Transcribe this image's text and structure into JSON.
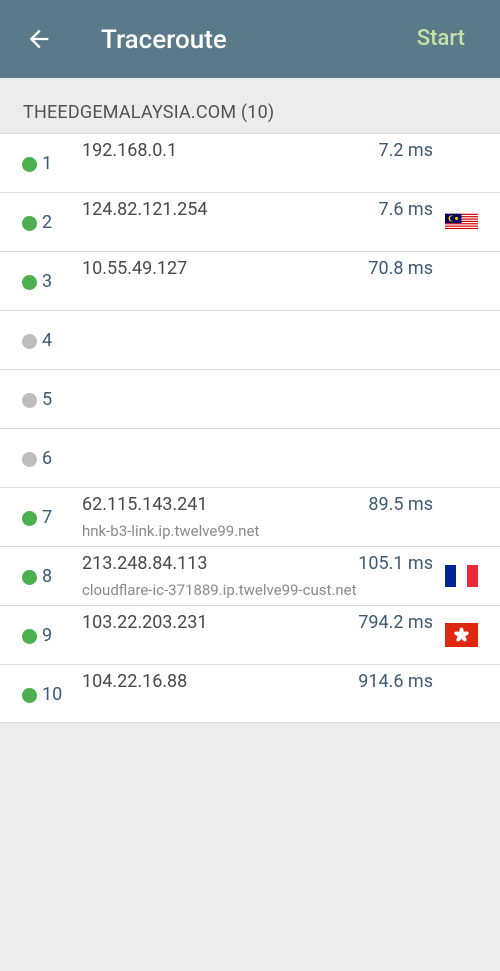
{
  "appbar": {
    "back_icon": "arrow-left-icon",
    "title": "Traceroute",
    "start_label": "Start",
    "bg_color": "#5a7a89",
    "start_color": "#c5e1a5"
  },
  "section": {
    "header": "THEEDGEMALAYSIA.COM (10)"
  },
  "colors": {
    "reached": "#4caf50",
    "no_reply": "#bdbdbd"
  },
  "hops": [
    {
      "num": "1",
      "ip": "192.168.0.1",
      "ms": "7.2 ms",
      "host": "",
      "status": "reached",
      "flag": ""
    },
    {
      "num": "2",
      "ip": "124.82.121.254",
      "ms": "7.6 ms",
      "host": "",
      "status": "reached",
      "flag": "malaysia-flag-icon"
    },
    {
      "num": "3",
      "ip": "10.55.49.127",
      "ms": "70.8 ms",
      "host": "",
      "status": "reached",
      "flag": ""
    },
    {
      "num": "4",
      "ip": "",
      "ms": "",
      "host": "",
      "status": "no_reply",
      "flag": ""
    },
    {
      "num": "5",
      "ip": "",
      "ms": "",
      "host": "",
      "status": "no_reply",
      "flag": ""
    },
    {
      "num": "6",
      "ip": "",
      "ms": "",
      "host": "",
      "status": "no_reply",
      "flag": ""
    },
    {
      "num": "7",
      "ip": "62.115.143.241",
      "ms": "89.5 ms",
      "host": "hnk-b3-link.ip.twelve99.net",
      "status": "reached",
      "flag": ""
    },
    {
      "num": "8",
      "ip": "213.248.84.113",
      "ms": "105.1 ms",
      "host": "cloudflare-ic-371889.ip.twelve99-cust.net",
      "status": "reached",
      "flag": "france-flag-icon"
    },
    {
      "num": "9",
      "ip": "103.22.203.231",
      "ms": "794.2 ms",
      "host": "",
      "status": "reached",
      "flag": "hong-kong-flag-icon"
    },
    {
      "num": "10",
      "ip": "104.22.16.88",
      "ms": "914.6 ms",
      "host": "",
      "status": "reached",
      "flag": ""
    }
  ]
}
